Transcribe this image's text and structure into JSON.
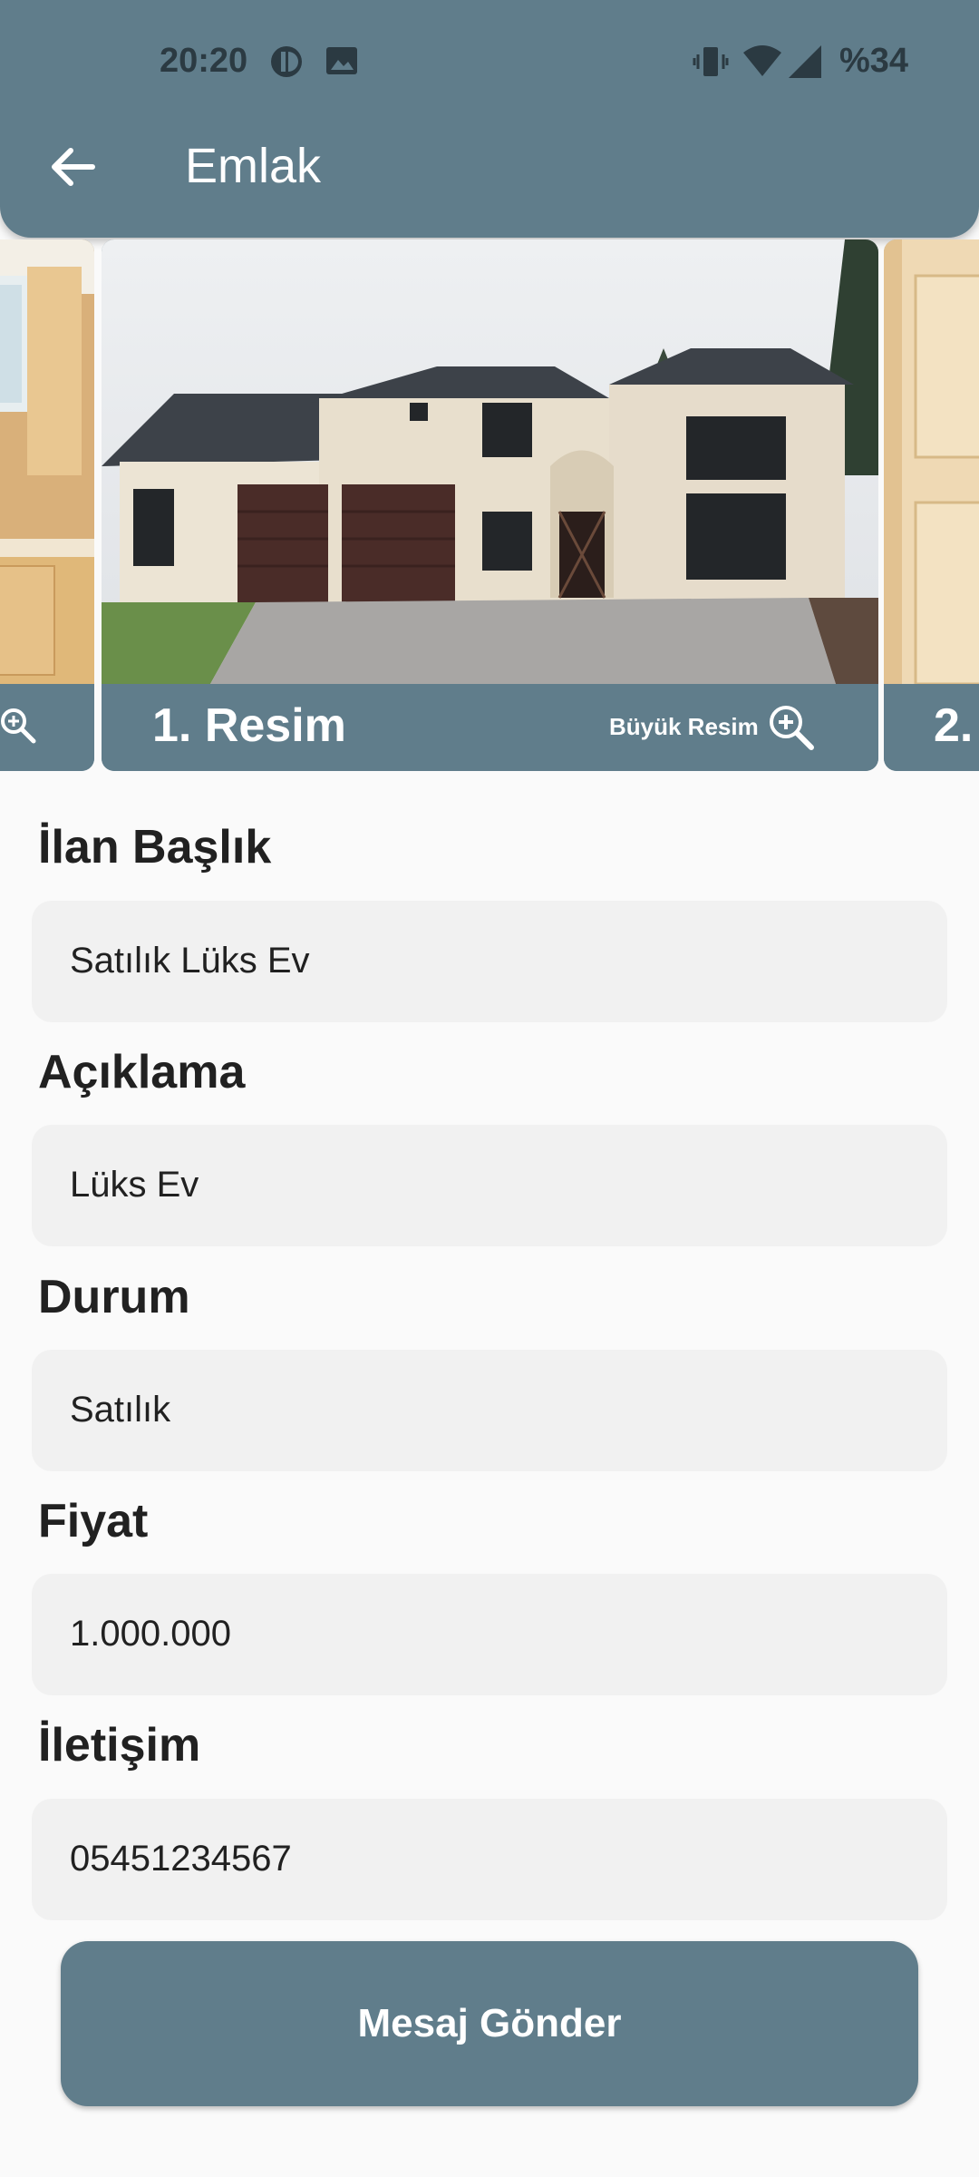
{
  "status_bar": {
    "time": "20:20",
    "battery": "%34"
  },
  "app_bar": {
    "title": "Emlak"
  },
  "carousel": {
    "current": {
      "title": "1. Resim",
      "big_label": "Büyük Resim"
    },
    "next": {
      "title": "2."
    }
  },
  "form": {
    "fields": [
      {
        "label": "İlan Başlık",
        "value": "Satılık Lüks Ev"
      },
      {
        "label": "Açıklama",
        "value": "Lüks Ev"
      },
      {
        "label": "Durum",
        "value": "Satılık"
      },
      {
        "label": "Fiyat",
        "value": "1.000.000"
      },
      {
        "label": "İletişim",
        "value": "05451234567"
      }
    ]
  },
  "actions": {
    "send_label": "Mesaj Gönder"
  },
  "colors": {
    "primary": "#607d8b",
    "background": "#fafafa",
    "field": "#f1f1f1"
  }
}
